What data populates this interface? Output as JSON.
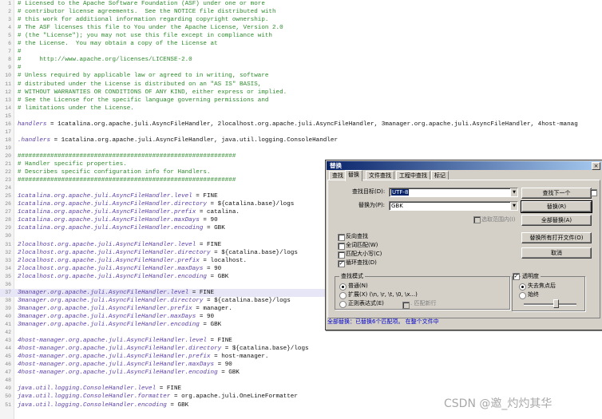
{
  "editor": {
    "lines": [
      {
        "num": "1",
        "text": "# Licensed to the Apache Software Foundation (ASF) under one or more",
        "kind": "comment"
      },
      {
        "num": "2",
        "text": "# contributor license agreements.  See the NOTICE file distributed with",
        "kind": "comment"
      },
      {
        "num": "3",
        "text": "# this work for additional information regarding copyright ownership.",
        "kind": "comment"
      },
      {
        "num": "4",
        "text": "# The ASF licenses this file to You under the Apache License, Version 2.0",
        "kind": "comment"
      },
      {
        "num": "5",
        "text": "# (the \"License\"); you may not use this file except in compliance with",
        "kind": "comment"
      },
      {
        "num": "6",
        "text": "# the License.  You may obtain a copy of the License at",
        "kind": "comment"
      },
      {
        "num": "7",
        "text": "#",
        "kind": "comment"
      },
      {
        "num": "8",
        "text": "#     http://www.apache.org/licenses/LICENSE-2.0",
        "kind": "comment"
      },
      {
        "num": "9",
        "text": "#",
        "kind": "comment"
      },
      {
        "num": "10",
        "text": "# Unless required by applicable law or agreed to in writing, software",
        "kind": "comment"
      },
      {
        "num": "11",
        "text": "# distributed under the License is distributed on an \"AS IS\" BASIS,",
        "kind": "comment"
      },
      {
        "num": "12",
        "text": "# WITHOUT WARRANTIES OR CONDITIONS OF ANY KIND, either express or implied.",
        "kind": "comment"
      },
      {
        "num": "13",
        "text": "# See the License for the specific language governing permissions and",
        "kind": "comment"
      },
      {
        "num": "14",
        "text": "# limitations under the License.",
        "kind": "comment"
      },
      {
        "num": "15",
        "text": "",
        "kind": "blank"
      },
      {
        "num": "16",
        "key": "handlers",
        "val": " = 1catalina.org.apache.juli.AsyncFileHandler, 2localhost.org.apache.juli.AsyncFileHandler, 3manager.org.apache.juli.AsyncFileHandler, 4host-manag",
        "kind": "prop"
      },
      {
        "num": "17",
        "text": "",
        "kind": "blank"
      },
      {
        "num": "18",
        "key": ".handlers",
        "val": " = 1catalina.org.apache.juli.AsyncFileHandler, java.util.logging.ConsoleHandler",
        "kind": "prop"
      },
      {
        "num": "19",
        "text": "",
        "kind": "blank"
      },
      {
        "num": "20",
        "text": "############################################################",
        "kind": "comment"
      },
      {
        "num": "21",
        "text": "# Handler specific properties.",
        "kind": "comment"
      },
      {
        "num": "22",
        "text": "# Describes specific configuration info for Handlers.",
        "kind": "comment"
      },
      {
        "num": "23",
        "text": "############################################################",
        "kind": "comment"
      },
      {
        "num": "24",
        "text": "",
        "kind": "blank"
      },
      {
        "num": "25",
        "key": "1catalina.org.apache.juli.AsyncFileHandler.level",
        "val": " = FINE",
        "kind": "prop"
      },
      {
        "num": "26",
        "key": "1catalina.org.apache.juli.AsyncFileHandler.directory",
        "val": " = ${catalina.base}/logs",
        "kind": "prop"
      },
      {
        "num": "27",
        "key": "1catalina.org.apache.juli.AsyncFileHandler.prefix",
        "val": " = catalina.",
        "kind": "prop"
      },
      {
        "num": "28",
        "key": "1catalina.org.apache.juli.AsyncFileHandler.maxDays",
        "val": " = 90",
        "kind": "prop"
      },
      {
        "num": "29",
        "key": "1catalina.org.apache.juli.AsyncFileHandler.encoding",
        "val": " = GBK",
        "kind": "prop"
      },
      {
        "num": "30",
        "text": "",
        "kind": "blank"
      },
      {
        "num": "31",
        "key": "2localhost.org.apache.juli.AsyncFileHandler.level",
        "val": " = FINE",
        "kind": "prop"
      },
      {
        "num": "32",
        "key": "2localhost.org.apache.juli.AsyncFileHandler.directory",
        "val": " = ${catalina.base}/logs",
        "kind": "prop"
      },
      {
        "num": "33",
        "key": "2localhost.org.apache.juli.AsyncFileHandler.prefix",
        "val": " = localhost.",
        "kind": "prop"
      },
      {
        "num": "34",
        "key": "2localhost.org.apache.juli.AsyncFileHandler.maxDays",
        "val": " = 90",
        "kind": "prop"
      },
      {
        "num": "35",
        "key": "2localhost.org.apache.juli.AsyncFileHandler.encoding",
        "val": " = GBK",
        "kind": "prop"
      },
      {
        "num": "36",
        "text": "",
        "kind": "blank"
      },
      {
        "num": "37",
        "key": "3manager.org.apache.juli.AsyncFileHandler.level",
        "val": " = FINE",
        "kind": "prop",
        "highlight": true
      },
      {
        "num": "38",
        "key": "3manager.org.apache.juli.AsyncFileHandler.directory",
        "val": " = ${catalina.base}/logs",
        "kind": "prop"
      },
      {
        "num": "39",
        "key": "3manager.org.apache.juli.AsyncFileHandler.prefix",
        "val": " = manager.",
        "kind": "prop"
      },
      {
        "num": "40",
        "key": "3manager.org.apache.juli.AsyncFileHandler.maxDays",
        "val": " = 90",
        "kind": "prop"
      },
      {
        "num": "41",
        "key": "3manager.org.apache.juli.AsyncFileHandler.encoding",
        "val": " = GBK",
        "kind": "prop"
      },
      {
        "num": "42",
        "text": "",
        "kind": "blank"
      },
      {
        "num": "43",
        "key": "4host-manager.org.apache.juli.AsyncFileHandler.level",
        "val": " = FINE",
        "kind": "prop"
      },
      {
        "num": "44",
        "key": "4host-manager.org.apache.juli.AsyncFileHandler.directory",
        "val": " = ${catalina.base}/logs",
        "kind": "prop"
      },
      {
        "num": "45",
        "key": "4host-manager.org.apache.juli.AsyncFileHandler.prefix",
        "val": " = host-manager.",
        "kind": "prop"
      },
      {
        "num": "46",
        "key": "4host-manager.org.apache.juli.AsyncFileHandler.maxDays",
        "val": " = 90",
        "kind": "prop"
      },
      {
        "num": "47",
        "key": "4host-manager.org.apache.juli.AsyncFileHandler.encoding",
        "val": " = GBK",
        "kind": "prop"
      },
      {
        "num": "48",
        "text": "",
        "kind": "blank"
      },
      {
        "num": "49",
        "key": "java.util.logging.ConsoleHandler.level",
        "val": " = FINE",
        "kind": "prop"
      },
      {
        "num": "50",
        "key": "java.util.logging.ConsoleHandler.formatter",
        "val": " = org.apache.juli.OneLineFormatter",
        "kind": "prop"
      },
      {
        "num": "51",
        "key": "java.util.logging.ConsoleHandler.encoding",
        "val": " = GBK",
        "kind": "prop"
      }
    ]
  },
  "dialog": {
    "title": "替换",
    "close": "×",
    "tabs": [
      "查找",
      "替换",
      "文件查找",
      "工程中查找",
      "标记"
    ],
    "find_label": "查找目标(D):",
    "find_value": "UTF-8",
    "replace_label": "替换为(P):",
    "replace_value": "GBK",
    "selection_only": "选取范围内(I)",
    "buttons": {
      "find_next": "查找下一个",
      "replace": "替换(R)",
      "replace_all": "全部替换(A)",
      "replace_all_open": "替换所有打开文件(O)",
      "cancel": "取消"
    },
    "options": {
      "backward": "反向查找",
      "whole_word": "全词匹配(W)",
      "match_case": "匹配大小写(C)",
      "wrap": "循环查找(D)"
    },
    "search_mode": {
      "title": "查找模式",
      "normal": "普通(N)",
      "extended": "扩展(X) (\\n, \\r, \\t, \\0, \\x...)",
      "regex": "正则表达式(E)",
      "dot_newline": ". 匹配新行"
    },
    "transparency": {
      "title": "透明度",
      "on_focus": "失去焦点后",
      "always": "始终",
      "level": 0.6
    },
    "status": "全部替换：已替换6个匹配项。  在整个文件中"
  },
  "watermark": "CSDN @邀_灼灼其华"
}
